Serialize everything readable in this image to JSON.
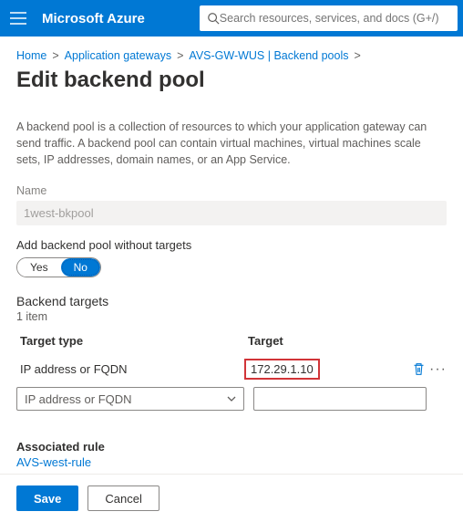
{
  "brand": "Microsoft Azure",
  "search": {
    "placeholder": "Search resources, services, and docs (G+/)"
  },
  "breadcrumbs": {
    "items": [
      "Home",
      "Application gateways",
      "AVS-GW-WUS | Backend pools"
    ]
  },
  "page": {
    "title": "Edit backend pool",
    "description": "A backend pool is a collection of resources to which your application gateway can send traffic. A backend pool can contain virtual machines, virtual machines scale sets, IP addresses, domain names, or an App Service.",
    "name_label": "Name",
    "name_value": "1west-bkpool",
    "add_without_targets_label": "Add backend pool without targets",
    "toggle_yes": "Yes",
    "toggle_no": "No",
    "backend_targets_label": "Backend targets",
    "item_count": "1 item",
    "headers": {
      "type": "Target type",
      "target": "Target"
    },
    "rows": [
      {
        "type": "IP address or FQDN",
        "target": "172.29.1.10"
      }
    ],
    "new_row_type_placeholder": "IP address or FQDN",
    "associated_label": "Associated rule",
    "associated_link": "AVS-west-rule"
  },
  "footer": {
    "save": "Save",
    "cancel": "Cancel"
  }
}
